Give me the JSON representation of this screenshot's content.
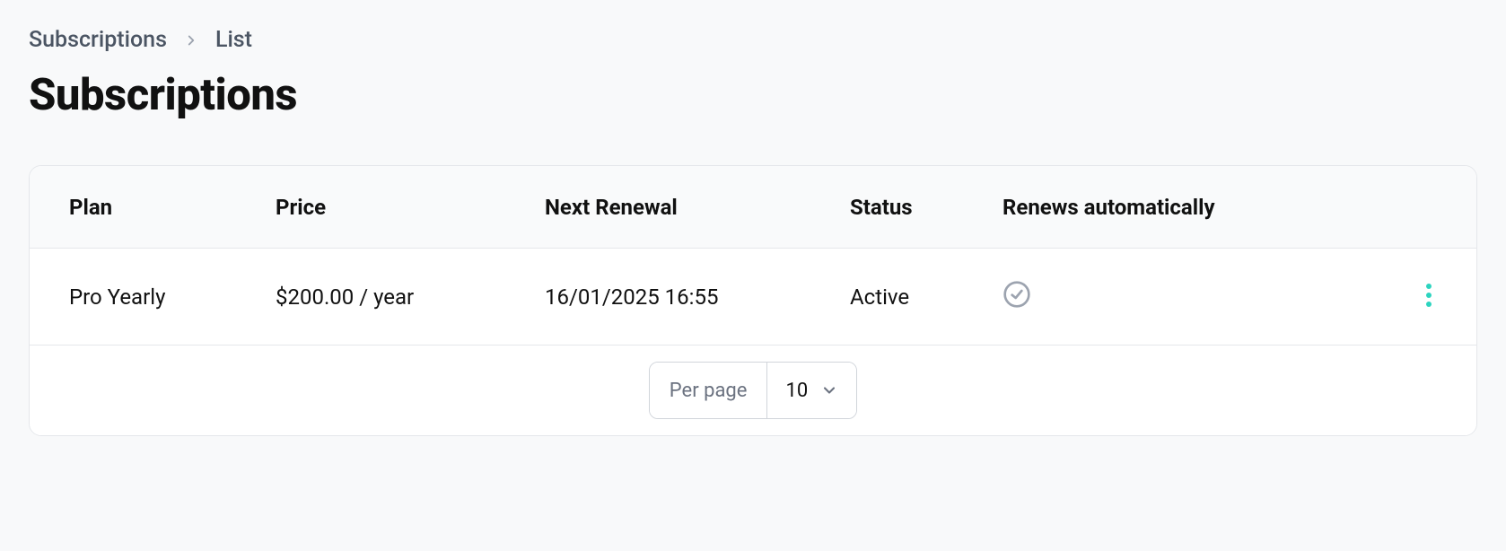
{
  "breadcrumb": {
    "parent": "Subscriptions",
    "current": "List"
  },
  "page_title": "Subscriptions",
  "table": {
    "headers": {
      "plan": "Plan",
      "price": "Price",
      "next_renewal": "Next Renewal",
      "status": "Status",
      "renews_auto": "Renews automatically"
    },
    "rows": [
      {
        "plan": "Pro Yearly",
        "price": "$200.00 / year",
        "next_renewal": "16/01/2025 16:55",
        "status": "Active",
        "renews_auto": true
      }
    ]
  },
  "pagination": {
    "per_page_label": "Per page",
    "per_page_value": "10"
  }
}
